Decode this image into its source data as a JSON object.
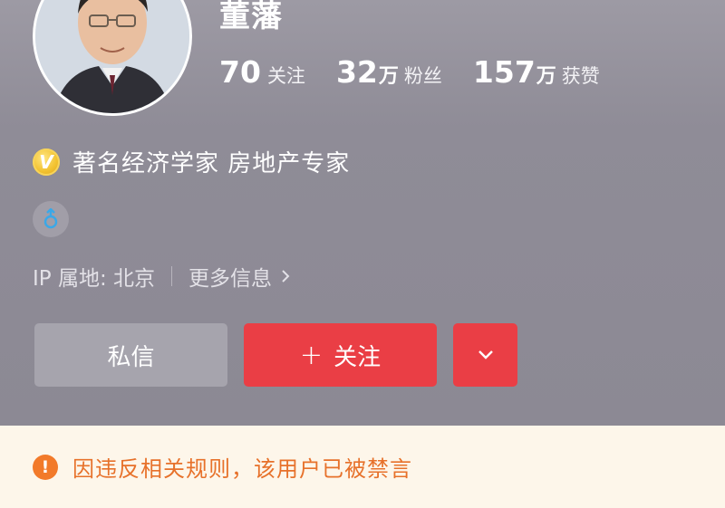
{
  "profile": {
    "name": "董藩",
    "avatar_icon": "person-portrait",
    "stats": [
      {
        "number": "70",
        "unit": "",
        "label": "关注"
      },
      {
        "number": "32",
        "unit": "万",
        "label": "粉丝"
      },
      {
        "number": "157",
        "unit": "万",
        "label": "获赞"
      }
    ],
    "verification": {
      "badge_glyph": "V",
      "badge_icon": "verified-badge-icon",
      "badge_color": "#f2c230",
      "text": "著名经济学家 房地产专家"
    },
    "gender_icon": "male-icon",
    "ip_label": "IP 属地: 北京",
    "more_info": "更多信息"
  },
  "actions": {
    "message_label": "私信",
    "follow_plus": "+",
    "follow_label": "关注",
    "accent_color": "#ea3e45"
  },
  "notice": {
    "icon_glyph": "!",
    "icon": "warning-icon",
    "text": "因违反相关规则，该用户已被禁言",
    "color": "#e7712a"
  }
}
